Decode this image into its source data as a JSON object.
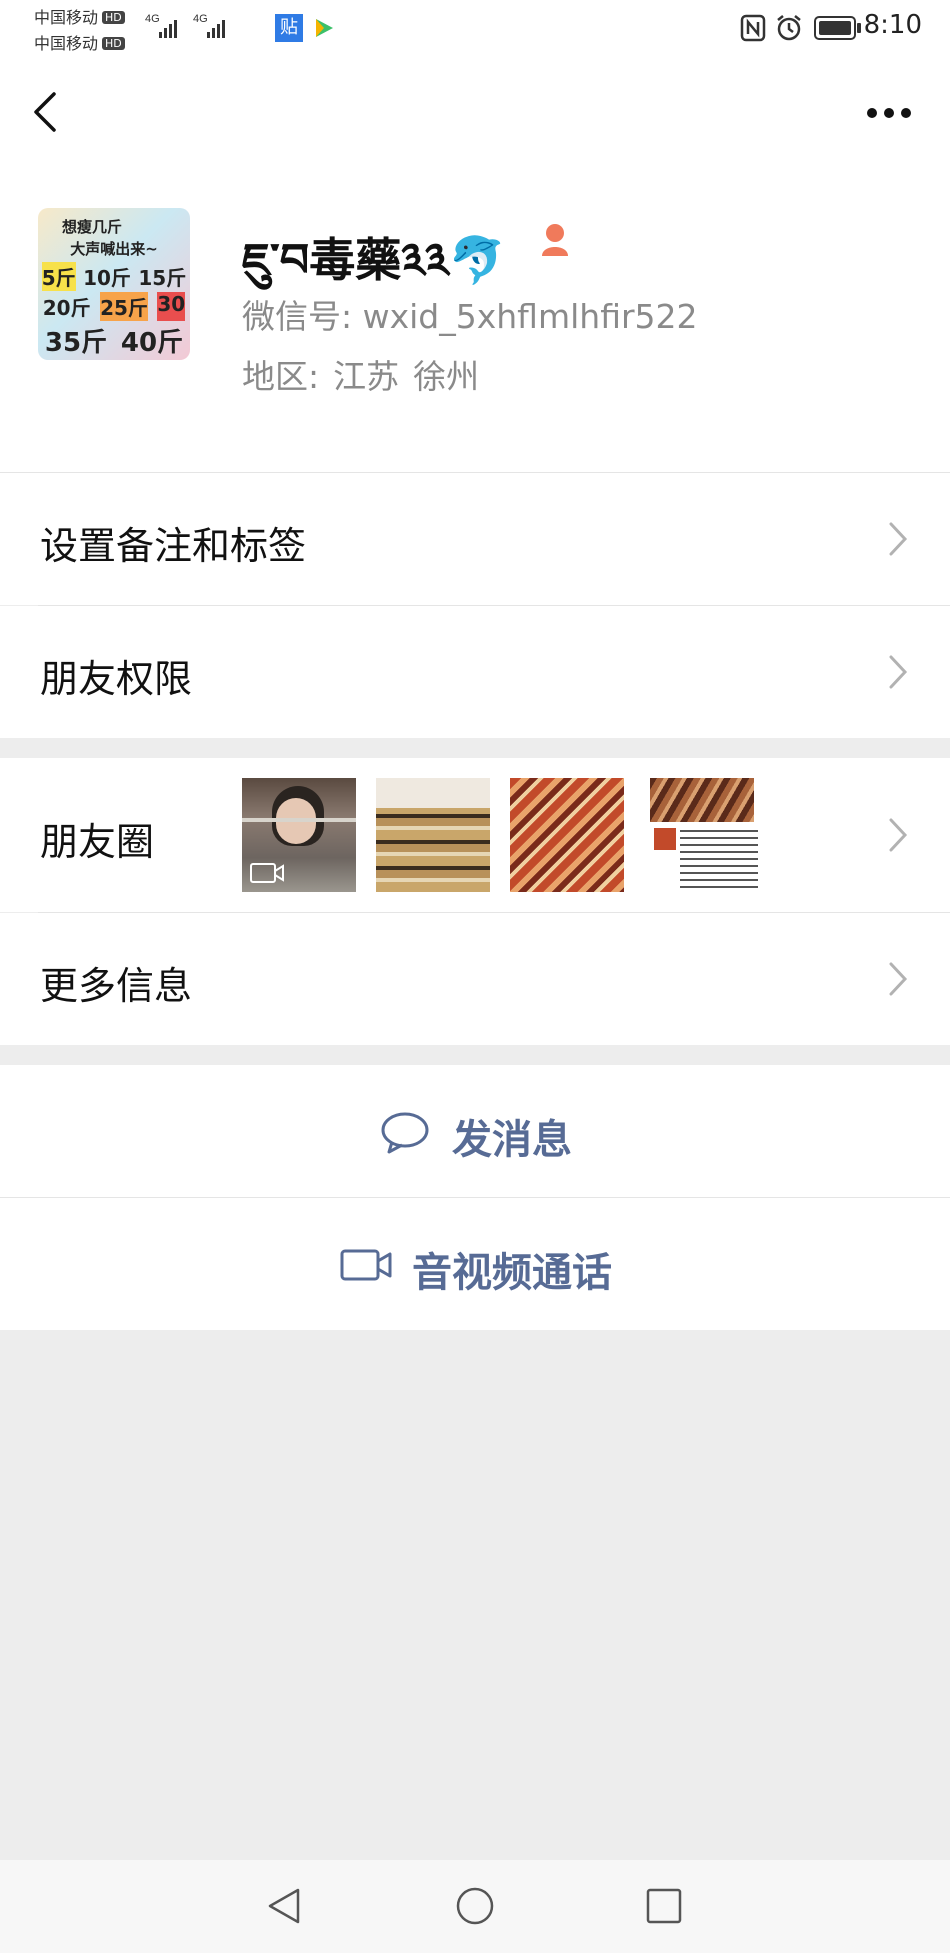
{
  "status_bar": {
    "carrier_1": "中国移动",
    "carrier_2": "中国移动",
    "hd_badge": "HD",
    "network_1": "4G",
    "network_2": "4G",
    "time": "8:10",
    "icons": [
      "signal-icon",
      "nfc-icon",
      "alarm-icon",
      "battery-icon"
    ]
  },
  "nav": {
    "back_icon": "back-icon",
    "more_icon": "more-icon"
  },
  "profile": {
    "avatar_text": {
      "line1": "想瘦几斤",
      "line2": "大声喊出来~",
      "line3": [
        "5斤",
        "10斤",
        "15斤"
      ],
      "line4": [
        "20斤",
        "25斤",
        "30"
      ],
      "line5": [
        "35斤",
        "40斤"
      ]
    },
    "name": "ཇུ་བ毒藥༣༣🐬",
    "gender_icon": "female-icon",
    "wechat_id": "微信号: wxid_5xhflmlhfir522",
    "region_label": "地区:",
    "region_province": "江苏",
    "region_city": "徐州"
  },
  "menu": {
    "set_remark": "设置备注和标签",
    "friend_permissions": "朋友权限",
    "moments": "朋友圈",
    "more_info": "更多信息"
  },
  "actions": {
    "send_message": "发消息",
    "av_call": "音视频通话"
  },
  "colors": {
    "link_blue": "#576b95",
    "page_bg": "#ededed",
    "secondary_text": "#8a8a8a"
  }
}
